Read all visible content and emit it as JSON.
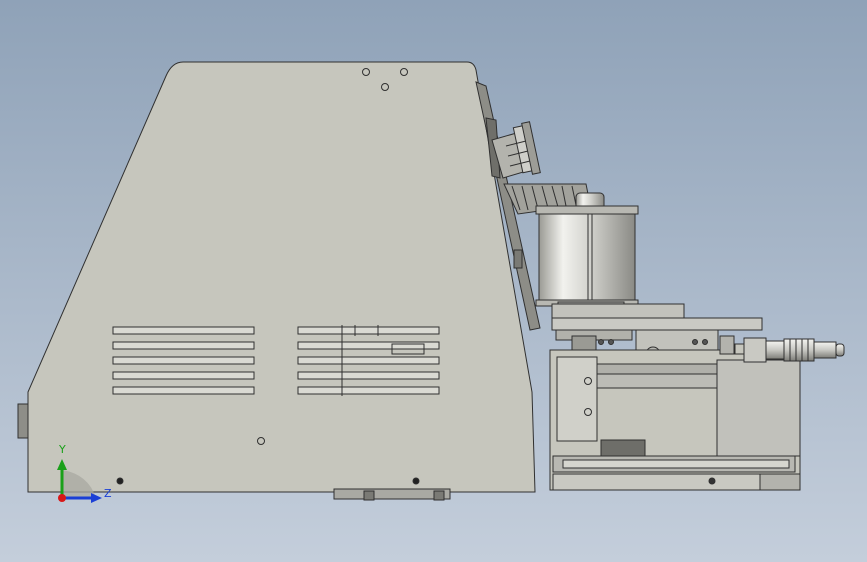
{
  "view": {
    "background_top": "#8fa2b8",
    "background_bottom": "#c4cedb"
  },
  "triad": {
    "y_label": "Y",
    "z_label": "Z",
    "y_color": "#1aa01a",
    "z_color": "#1a3fd6",
    "origin_color": "#d81818"
  },
  "colors": {
    "housing": "#c6c6bd",
    "edge": "#303030",
    "steel": "#c9c9c4",
    "chrome": "#e6e6e2"
  }
}
